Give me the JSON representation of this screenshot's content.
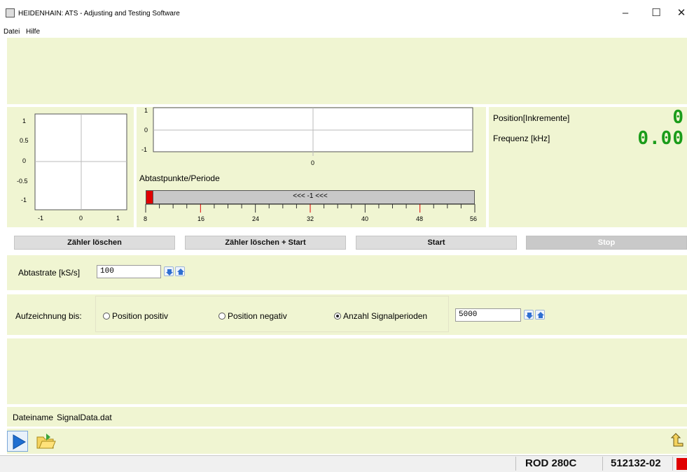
{
  "window": {
    "title": "HEIDENHAIN: ATS - Adjusting and Testing Software",
    "minimize": "–",
    "maximize": "☐",
    "close": "✕"
  },
  "menu": {
    "items": [
      "Datei",
      "Hilfe"
    ]
  },
  "lissajous": {
    "y_ticks": [
      "1",
      "0.5",
      "0",
      "-0.5",
      "-1"
    ],
    "x_ticks": [
      "-1",
      "0",
      "1"
    ]
  },
  "signal_plot": {
    "y_ticks": [
      "1",
      "0",
      "-1"
    ],
    "x_tick": "0"
  },
  "period_scale": {
    "label": "Abtastpunkte/Periode",
    "bar_text": "<<< -1 <<<",
    "ticks": [
      "8",
      "16",
      "24",
      "32",
      "40",
      "48",
      "56"
    ],
    "min": 8,
    "max": 56
  },
  "readout": {
    "position_label": "Position[Inkremente]",
    "position_value": "0",
    "frequency_label": "Frequenz [kHz]",
    "frequency_value": "0.00"
  },
  "buttons": {
    "clear_counter": "Zähler löschen",
    "clear_and_start": "Zähler löschen + Start",
    "start": "Start",
    "stop": "Stop"
  },
  "sampling": {
    "label": "Abtastrate [kS/s]",
    "value": "100"
  },
  "recording": {
    "label": "Aufzeichnung bis:",
    "options": [
      "Position positiv",
      "Position negativ",
      "Anzahl Signalperioden"
    ],
    "selected_index": 2,
    "value": "5000"
  },
  "file": {
    "label": "Dateiname",
    "name": "SignalData.dat"
  },
  "status": {
    "device": "ROD 280C",
    "id": "512132-02"
  },
  "colors": {
    "panel": "#f0f5d2",
    "readout_green": "#1a9c1a",
    "marker_red": "#e00000"
  }
}
